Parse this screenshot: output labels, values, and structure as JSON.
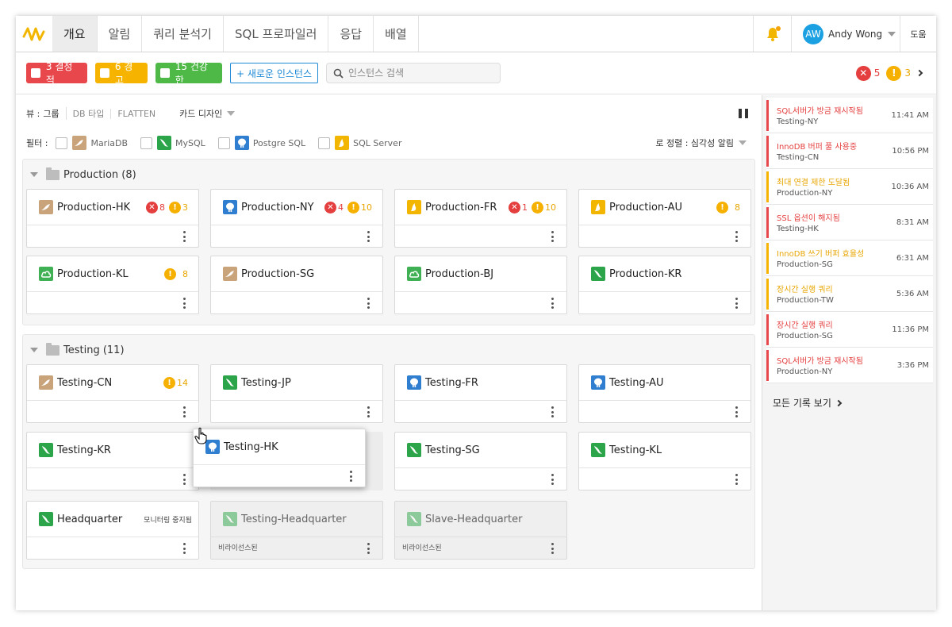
{
  "nav": {
    "tabs": [
      "개요",
      "알림",
      "쿼리 분석기",
      "SQL 프로파일러",
      "응답",
      "배열"
    ],
    "user": {
      "initials": "AW",
      "name": "Andy Wong"
    },
    "help": "도움"
  },
  "toolbar": {
    "critical": "3 결정적",
    "warning": "6 경고",
    "healthy": "15 건강한",
    "new_instance": "+ 새로운 인스턴스",
    "search_placeholder": "인스턴스 검색",
    "critical_count": "5",
    "warning_count": "3"
  },
  "view": {
    "label": "뷰 :",
    "options": [
      "그룹",
      "DB 타입",
      "FLATTEN"
    ],
    "design": "카드 디자인"
  },
  "filter": {
    "label": "필터 :",
    "items": [
      "MariaDB",
      "MySQL",
      "Postgre SQL",
      "SQL Server"
    ],
    "sort": "로 정렬 : 심각성 알림"
  },
  "groups": [
    {
      "title": "Production (8)"
    },
    {
      "title": "Testing (11)"
    }
  ],
  "cards": {
    "prod_hk": {
      "name": "Production-HK",
      "err": "8",
      "warn": "3"
    },
    "prod_ny": {
      "name": "Production-NY",
      "err": "4",
      "warn": "10"
    },
    "prod_fr": {
      "name": "Production-FR",
      "err": "1",
      "warn": "10"
    },
    "prod_au": {
      "name": "Production-AU",
      "warn": "8"
    },
    "prod_kl": {
      "name": "Production-KL",
      "warn": "8"
    },
    "prod_sg": {
      "name": "Production-SG"
    },
    "prod_bj": {
      "name": "Production-BJ"
    },
    "prod_kr": {
      "name": "Production-KR"
    },
    "test_cn": {
      "name": "Testing-CN",
      "warn": "14"
    },
    "test_jp": {
      "name": "Testing-JP"
    },
    "test_fr": {
      "name": "Testing-FR"
    },
    "test_au": {
      "name": "Testing-AU"
    },
    "test_kr": {
      "name": "Testing-KR"
    },
    "test_hk": {
      "name": "Testing-HK"
    },
    "test_sg": {
      "name": "Testing-SG"
    },
    "test_kl": {
      "name": "Testing-KL"
    },
    "hq": {
      "name": "Headquarter",
      "note": "모니터링 중지됨"
    },
    "test_hq": {
      "name": "Testing-Headquarter",
      "note": "비라이선스된"
    },
    "slave_hq": {
      "name": "Slave-Headquarter",
      "note": "비라이선스된"
    }
  },
  "logs": [
    {
      "title": "SQL서버가 방금 재시작됨",
      "sub": "Testing-NY",
      "time": "11:41 AM",
      "level": "error"
    },
    {
      "title": "InnoDB 버퍼 풀 사용중",
      "sub": "Testing-CN",
      "time": "10:56 PM",
      "level": "error"
    },
    {
      "title": "최대 연결 제한 도달됨",
      "sub": "Production-NY",
      "time": "10:36 AM",
      "level": "warn"
    },
    {
      "title": "SSL 옵션이 해지됨",
      "sub": "Testing-HK",
      "time": "8:31 AM",
      "level": "error"
    },
    {
      "title": "InnoDB 쓰기 버퍼 효율성",
      "sub": "Production-SG",
      "time": "6:31 AM",
      "level": "warn"
    },
    {
      "title": "장시간 실행 쿼리",
      "sub": "Production-TW",
      "time": "5:36 AM",
      "level": "warn"
    },
    {
      "title": "장시간 실행 쿼리",
      "sub": "Production-SG",
      "time": "11:36 PM",
      "level": "error"
    },
    {
      "title": "SQL서버가 방금 재시작됨",
      "sub": "Production-NY",
      "time": "3:36 PM",
      "level": "error"
    }
  ],
  "all_logs": "모든 기록 보기",
  "colors": {
    "error": "#e8484c",
    "warn": "#f6b400",
    "healthy": "#4fb948",
    "accent": "#1ba1e2"
  }
}
